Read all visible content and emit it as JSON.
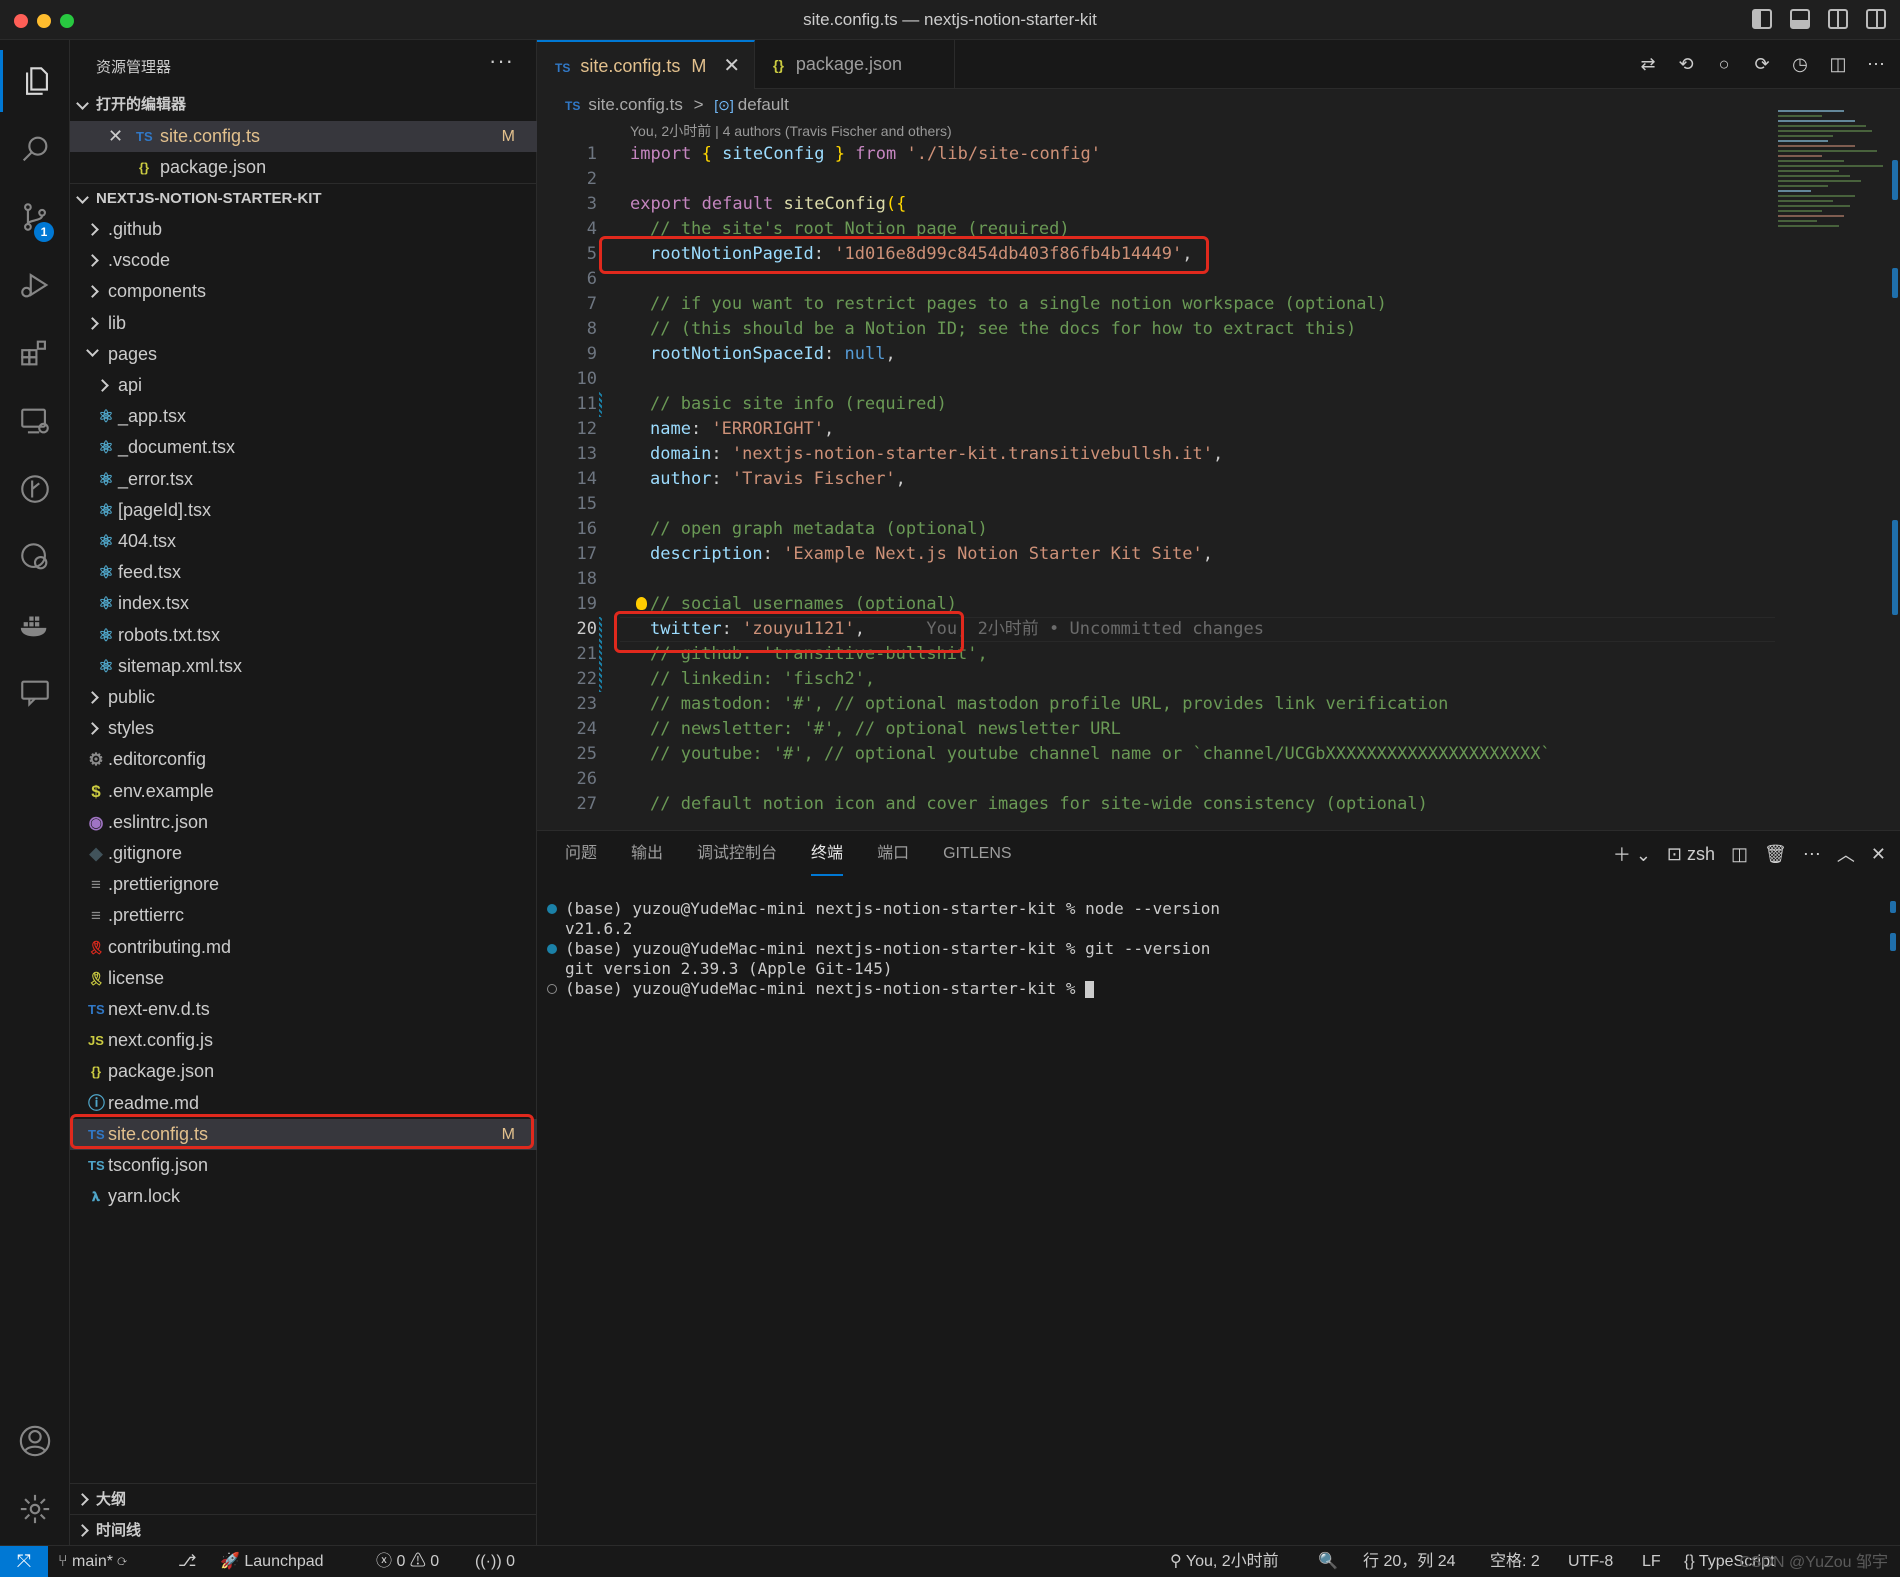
{
  "window": {
    "title": "site.config.ts — nextjs-notion-starter-kit"
  },
  "activity": {
    "scm_badge": "1"
  },
  "explorer": {
    "title": "资源管理器",
    "more": "···",
    "open_editors": {
      "label": "打开的编辑器",
      "items": [
        {
          "name": "site.config.ts",
          "icon": "TS",
          "flag": "M"
        },
        {
          "name": "package.json",
          "icon": "{}"
        }
      ]
    },
    "project": {
      "label": "NEXTJS-NOTION-STARTER-KIT",
      "items": [
        {
          "name": ".github",
          "type": "folder"
        },
        {
          "name": ".vscode",
          "type": "folder"
        },
        {
          "name": "components",
          "type": "folder"
        },
        {
          "name": "lib",
          "type": "folder"
        },
        {
          "name": "pages",
          "type": "folder-open"
        },
        {
          "name": "api",
          "type": "folder"
        },
        {
          "name": "_app.tsx",
          "type": "tsx"
        },
        {
          "name": "_document.tsx",
          "type": "tsx"
        },
        {
          "name": "_error.tsx",
          "type": "tsx"
        },
        {
          "name": "[pageId].tsx",
          "type": "tsx"
        },
        {
          "name": "404.tsx",
          "type": "tsx"
        },
        {
          "name": "feed.tsx",
          "type": "tsx"
        },
        {
          "name": "index.tsx",
          "type": "tsx"
        },
        {
          "name": "robots.txt.tsx",
          "type": "tsx"
        },
        {
          "name": "sitemap.xml.tsx",
          "type": "tsx"
        },
        {
          "name": "public",
          "type": "folder"
        },
        {
          "name": "styles",
          "type": "folder"
        },
        {
          "name": ".editorconfig",
          "type": "gear"
        },
        {
          "name": ".env.example",
          "type": "dollar"
        },
        {
          "name": ".eslintrc.json",
          "type": "eslint"
        },
        {
          "name": ".gitignore",
          "type": "git"
        },
        {
          "name": ".prettierignore",
          "type": "lines"
        },
        {
          "name": ".prettierrc",
          "type": "lines"
        },
        {
          "name": "contributing.md",
          "type": "ribbon-red"
        },
        {
          "name": "license",
          "type": "ribbon-yellow"
        },
        {
          "name": "next-env.d.ts",
          "type": "ts"
        },
        {
          "name": "next.config.js",
          "type": "js"
        },
        {
          "name": "package.json",
          "type": "json"
        },
        {
          "name": "readme.md",
          "type": "info"
        },
        {
          "name": "site.config.ts",
          "type": "ts",
          "flag": "M"
        },
        {
          "name": "tsconfig.json",
          "type": "tsconfig"
        },
        {
          "name": "yarn.lock",
          "type": "yarn"
        }
      ]
    },
    "outline_label": "大纲",
    "timeline_label": "时间线"
  },
  "editor": {
    "tabs": [
      {
        "label": "site.config.ts",
        "flag": "M",
        "icon": "TS"
      },
      {
        "label": "package.json",
        "icon": "{}"
      }
    ],
    "breadcrumb": {
      "file": "site.config.ts",
      "separator": ">",
      "symbol": "default"
    },
    "codelens": "You, 2小时前 | 4 authors (Travis Fischer and others)",
    "line_numbers": [
      "1",
      "2",
      "3",
      "4",
      "5",
      "6",
      "7",
      "8",
      "9",
      "10",
      "11",
      "12",
      "13",
      "14",
      "15",
      "16",
      "17",
      "18",
      "19",
      "20",
      "21",
      "22",
      "23",
      "24",
      "25",
      "26",
      "27"
    ],
    "code": {
      "l1_import": "import",
      "l1_open": "{",
      "l1_name": "siteConfig",
      "l1_close": "}",
      "l1_from": "from",
      "l1_path": "'./lib/site-config'",
      "l3_export": "export default",
      "l3_fn": "siteConfig",
      "l3_paren": "({",
      "l4": "// the site's root Notion page (required)",
      "l5_key": "rootNotionPageId",
      "l5_val": "'1d016e8d99c8454db403f86fb4b14449'",
      "l7": "// if you want to restrict pages to a single notion workspace (optional)",
      "l8": "// (this should be a Notion ID; see the docs for how to extract this)",
      "l9_key": "rootNotionSpaceId",
      "l9_val": "null",
      "l11": "// basic site info (required)",
      "l12_key": "name",
      "l12_val": "'ERRORIGHT'",
      "l13_key": "domain",
      "l13_val": "'nextjs-notion-starter-kit.transitivebullsh.it'",
      "l14_key": "author",
      "l14_val": "'Travis Fischer'",
      "l16": "// open graph metadata (optional)",
      "l17_key": "description",
      "l17_val": "'Example Next.js Notion Starter Kit Site'",
      "l19": "// social usernames (optional)",
      "l20_key": "twitter",
      "l20_val": "'zouyu1121'",
      "l20_blame": "You, 2小时前 • Uncommitted changes",
      "l21": "// github: 'transitive-bullshit',",
      "l22": "// linkedin: 'fisch2',",
      "l23": "// mastodon: '#', // optional mastodon profile URL, provides link verification",
      "l24": "// newsletter: '#', // optional newsletter URL",
      "l25": "// youtube: '#', // optional youtube channel name or `channel/UCGbXXXXXXXXXXXXXXXXXXXXX`",
      "l27": "// default notion icon and cover images for site-wide consistency (optional)"
    }
  },
  "panel": {
    "tabs": [
      "问题",
      "输出",
      "调试控制台",
      "终端",
      "端口",
      "GITLENS"
    ],
    "active_tab": "终端",
    "shell": "zsh",
    "terminal": [
      "(base) yuzou@YudeMac-mini nextjs-notion-starter-kit % node --version",
      "v21.6.2",
      "(base) yuzou@YudeMac-mini nextjs-notion-starter-kit % git --version",
      "git version 2.39.3 (Apple Git-145)",
      "(base) yuzou@YudeMac-mini nextjs-notion-starter-kit % "
    ]
  },
  "statusbar": {
    "branch": "main*",
    "launchpad": "Launchpad",
    "errors": "0",
    "warnings": "0",
    "ports": "0",
    "blame": "You, 2小时前",
    "position": "行 20，列 24",
    "spaces": "空格: 2",
    "encoding": "UTF-8",
    "eol": "LF",
    "language": "TypeScript",
    "watermark": "CSDN @YuZou 邹宇"
  }
}
